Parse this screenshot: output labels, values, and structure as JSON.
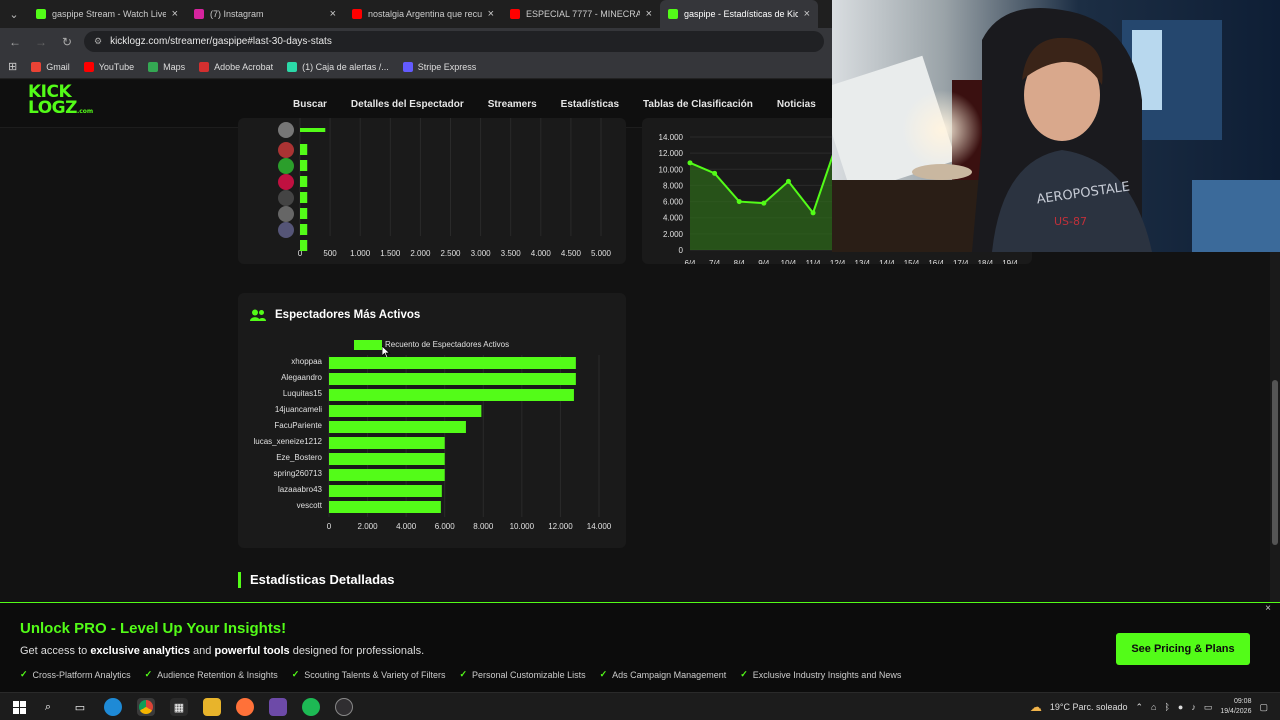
{
  "browser": {
    "tabs": [
      {
        "title": "gaspipe Stream - Watch Live on",
        "color": "#53fc18",
        "active": false
      },
      {
        "title": "(7) Instagram",
        "color": "#d6249f",
        "active": false
      },
      {
        "title": "nostalgia Argentina que recuer",
        "color": "#ff0000",
        "active": false
      },
      {
        "title": "ESPECIAL 7777 - MINECRAFT: I",
        "color": "#ff0000",
        "active": false
      },
      {
        "title": "gaspipe - Estadísticas de Kick",
        "color": "#53fc18",
        "active": true
      }
    ],
    "url": "kicklogz.com/streamer/gaspipe#last-30-days-stats",
    "bookmarks": [
      {
        "label": "Gmail",
        "color": "#ea4335"
      },
      {
        "label": "YouTube",
        "color": "#ff0000"
      },
      {
        "label": "Maps",
        "color": "#34a853"
      },
      {
        "label": "Adobe Acrobat",
        "color": "#d32f2f"
      },
      {
        "label": "(1) Caja de alertas /...",
        "color": "#2bd9a8"
      },
      {
        "label": "Stripe Express",
        "color": "#635bff"
      }
    ]
  },
  "site": {
    "logo_line1": "KICK",
    "logo_line2": "LOGZ",
    "logo_suffix": ".com",
    "menu": [
      "Buscar",
      "Detalles del Espectador",
      "Streamers",
      "Estadísticas",
      "Tablas de Clasificación",
      "Noticias",
      "Premi"
    ]
  },
  "top_left_chart": {
    "xticks": [
      "0",
      "500",
      "1.000",
      "1.500",
      "2.000",
      "2.500",
      "3.000",
      "3.500",
      "4.000",
      "4.500",
      "5.000"
    ]
  },
  "top_right_chart": {
    "yticks": [
      "14.000",
      "12.000",
      "10.000",
      "8.000",
      "6.000",
      "4.000",
      "2.000",
      "0"
    ],
    "xticks": [
      "6/4",
      "7/4",
      "8/4",
      "9/4",
      "10/4",
      "11/4",
      "12/4",
      "13/4",
      "14/4",
      "15/4",
      "16/4",
      "17/4",
      "18/4",
      "19/4"
    ]
  },
  "active_viewers": {
    "title": "Espectadores Más Activos",
    "legend": "Recuento de Espectadores Activos",
    "xticks": [
      "0",
      "2.000",
      "4.000",
      "6.000",
      "8.000",
      "10.000",
      "12.000",
      "14.000"
    ]
  },
  "chart_data": [
    {
      "type": "bar",
      "orientation": "horizontal",
      "title": "Espectadores Más Activos",
      "categories": [
        "xhoppaa",
        "Alegaandro",
        "Luquitas15",
        "14juancameli",
        "FacuPariente",
        "lucas_xeneize1212",
        "Eze_Bostero",
        "spring260713",
        "lazaaabro43",
        "vescott"
      ],
      "series": [
        {
          "name": "Recuento de Espectadores Activos",
          "values": [
            12800,
            12800,
            12700,
            7900,
            7100,
            6000,
            6000,
            6000,
            5850,
            5800
          ]
        }
      ],
      "xlim": [
        0,
        14000
      ]
    },
    {
      "type": "bar",
      "orientation": "horizontal",
      "categories": [
        "1",
        "2",
        "3",
        "4",
        "5",
        "6",
        "7",
        "8"
      ],
      "series": [
        {
          "values": [
            420,
            120,
            120,
            120,
            120,
            120,
            120,
            120
          ]
        }
      ],
      "xlim": [
        0,
        5000
      ]
    },
    {
      "type": "area",
      "x": [
        "6/4",
        "7/4",
        "8/4",
        "9/4",
        "10/4",
        "11/4",
        "12/4",
        "13/4",
        "14/4",
        "15/4",
        "16/4",
        "17/4",
        "18/4",
        "19/4"
      ],
      "series": [
        {
          "values": [
            10800,
            9500,
            6000,
            5800,
            8500,
            4600,
            13500,
            null,
            null,
            null,
            null,
            null,
            null,
            null
          ]
        }
      ],
      "ylim": [
        0,
        14000
      ]
    }
  ],
  "section_title": "Estadísticas Detalladas",
  "promo": {
    "title": "Unlock PRO - Level Up Your Insights!",
    "sub_a": "Get access to ",
    "sub_b": "exclusive analytics",
    "sub_c": " and ",
    "sub_d": "powerful tools",
    "sub_e": " designed for professionals.",
    "features": [
      "Cross-Platform Analytics",
      "Audience Retention & Insights",
      "Scouting Talents & Variety of Filters",
      "Personal Customizable Lists",
      "Ads Campaign Management",
      "Exclusive Industry Insights and News"
    ],
    "cta": "See Pricing & Plans",
    "close": "×"
  },
  "taskbar": {
    "weather": "19°C  Parc. soleado",
    "time": "09:08",
    "date": "19/4/2026"
  },
  "colors": {
    "accent": "#53fc18",
    "bg": "#121212",
    "card": "#1a1a1a"
  }
}
